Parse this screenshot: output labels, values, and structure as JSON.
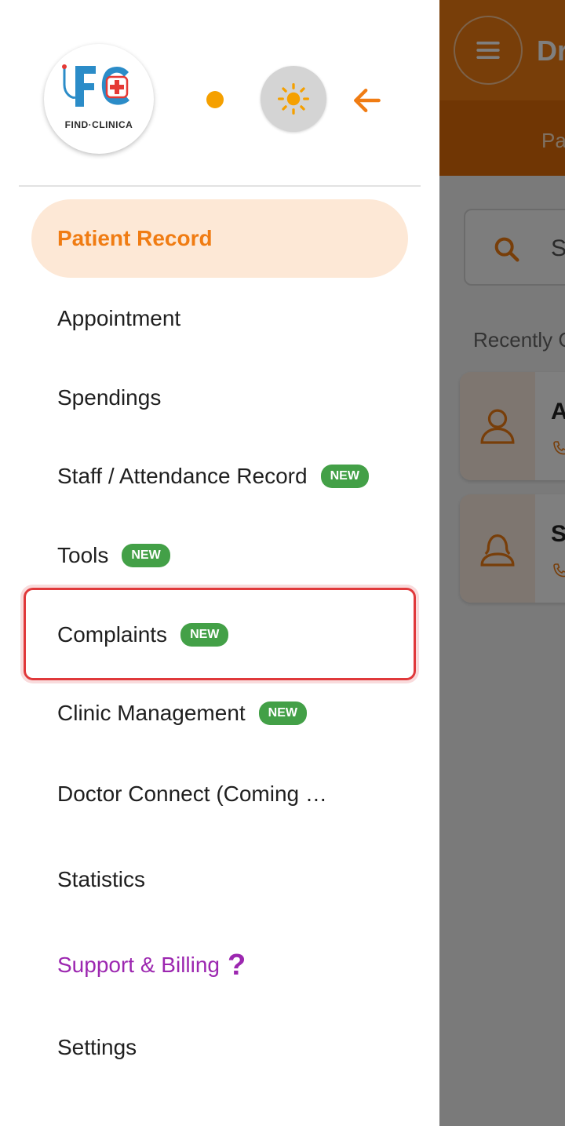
{
  "background": {
    "title": "Dr",
    "tab_label": "Pa",
    "search_placeholder": "S",
    "recent_label": "Recently C",
    "cards": [
      {
        "initial": "A"
      },
      {
        "initial": "S"
      }
    ]
  },
  "drawer": {
    "logo_text": "FIND·CLINICA",
    "items": [
      {
        "label": "Patient Record",
        "active": true
      },
      {
        "label": "Appointment"
      },
      {
        "label": "Spendings"
      },
      {
        "label": "Staff / Attendance Record",
        "badge": "NEW"
      },
      {
        "label": "Tools",
        "badge": "NEW"
      },
      {
        "label": "Complaints",
        "badge": "NEW"
      },
      {
        "label": "Clinic Management",
        "badge": "NEW"
      },
      {
        "label": "Doctor Connect (Coming …"
      },
      {
        "label": "Statistics"
      },
      {
        "label": "Support & Billing",
        "help_icon": "?"
      },
      {
        "label": "Settings"
      }
    ]
  },
  "colors": {
    "accent": "#f07c13",
    "active_bg": "#fde8d6",
    "badge_green": "#43a047",
    "support_purple": "#9c27b0",
    "highlight_red": "#e0393b"
  },
  "icons": {
    "theme": "sun-icon",
    "back": "arrow-left-icon",
    "menu": "hamburger-menu-icon",
    "search": "search-icon",
    "avatar": "person-icon",
    "phone": "phone-icon"
  }
}
